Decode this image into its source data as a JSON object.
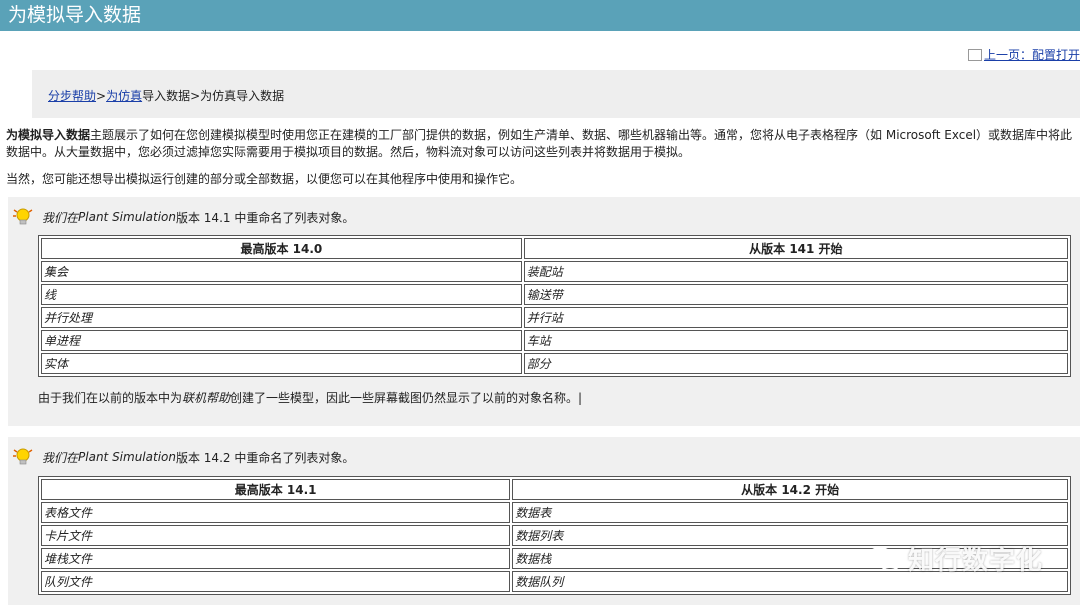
{
  "title": "为模拟导入数据",
  "prev_link": "上一页：配置打开",
  "breadcrumb": {
    "link1": "分步帮助",
    "sep1": ">",
    "link2": "为仿真",
    "after_link2": "导入数据",
    "sep2": ">",
    "current": "为仿真导入数据"
  },
  "intro": {
    "bold_title": "为模拟导入数据",
    "text": "主题展示了如何在您创建模拟模型时使用您正在建模的工厂部门提供的数据，例如生产清单、数据、哪些机器输出等。通常，您将从电子表格程序（如 Microsoft Excel）或数据库中将此数据中。从大量数据中，您必须过滤掉您实际需要用于模拟项目的数据。然后，物料流对象可以访问这些列表并将数据用于模拟。",
    "para2": "当然，您可能还想导出模拟运行创建的部分或全部数据，以便您可以在其他程序中使用和操作它。"
  },
  "note1": {
    "prefix": "我们在",
    "product": "Plant Simulation",
    "suffix": "版本 14.1 中重命名了列表对象。",
    "headers": [
      "最高版本 14.0",
      "从版本 141 开始"
    ],
    "rows": [
      [
        "集会",
        "装配站"
      ],
      [
        "线",
        "输送带"
      ],
      [
        "并行处理",
        "并行站"
      ],
      [
        "单进程",
        "车站"
      ],
      [
        "实体",
        "部分"
      ]
    ],
    "footnote_pre": "由于我们在以前的版本中为",
    "footnote_italic": "联机帮助",
    "footnote_post": "创建了一些模型，因此一些屏幕截图仍然显示了以前的对象名称。|"
  },
  "note2": {
    "prefix": "我们在",
    "product": "Plant Simulation",
    "suffix": "版本 14.2 中重命名了列表对象。",
    "headers": [
      "最高版本 14.1",
      "从版本 14.2 开始"
    ],
    "rows": [
      [
        "表格文件",
        "数据表"
      ],
      [
        "卡片文件",
        "数据列表"
      ],
      [
        "堆栈文件",
        "数据栈"
      ],
      [
        "队列文件",
        "数据队列"
      ]
    ]
  },
  "watermark": "知行数字化",
  "icons": {
    "note": "lightbulb-icon",
    "watermark": "wechat-icon"
  },
  "colors": {
    "titlebar": "#5aa2b8",
    "link": "#1a3fa8",
    "note_bg": "#f0f0f0"
  }
}
